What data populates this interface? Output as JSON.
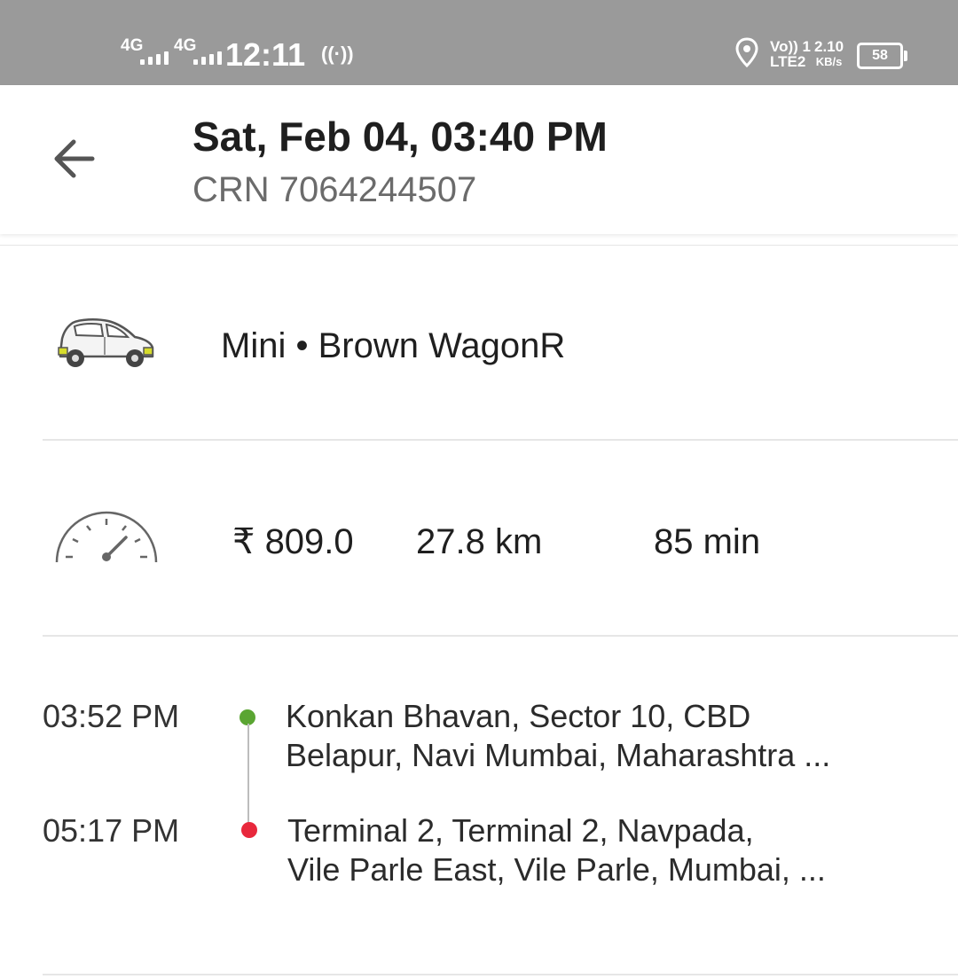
{
  "status_bar": {
    "network_1": "4G",
    "network_2": "4G",
    "time": "12:11",
    "volte_line1": "Vo)) 1",
    "volte_line2": "LTE2",
    "speed_value": "2.10",
    "speed_unit": "KB/s",
    "battery": "58"
  },
  "header": {
    "title": "Sat, Feb 04, 03:40 PM",
    "crn": "CRN 7064244507"
  },
  "ride": {
    "vehicle": "Mini • Brown WagonR",
    "fare": "₹ 809.0",
    "distance": "27.8 km",
    "duration": "85 min"
  },
  "route": {
    "pickup": {
      "time": "03:52 PM",
      "address_line1": "Konkan Bhavan, Sector 10, CBD",
      "address_line2": "Belapur, Navi Mumbai, Maharashtra ...",
      "dot_color": "#5aa532"
    },
    "drop": {
      "time": "05:17 PM",
      "address_line1": "Terminal 2, Terminal 2, Navpada,",
      "address_line2": "Vile Parle East, Vile Parle, Mumbai, ...",
      "dot_color": "#e8283c"
    }
  }
}
